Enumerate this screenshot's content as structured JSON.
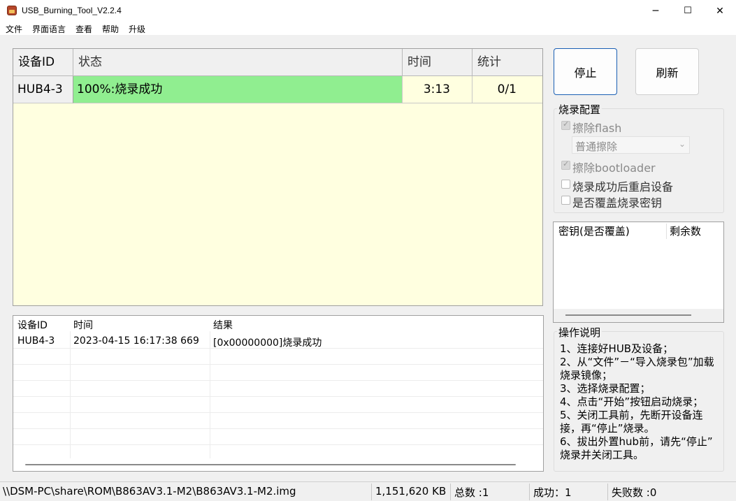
{
  "window": {
    "title": "USB_Burning_Tool_V2.2.4",
    "minimize": "─",
    "maximize": "☐",
    "close": "✕"
  },
  "menu": [
    "文件",
    "界面语言",
    "查看",
    "帮助",
    "升级"
  ],
  "grid": {
    "headers": [
      "设备ID",
      "状态",
      "时间",
      "统计"
    ],
    "rows": [
      {
        "device_id": "HUB4-3",
        "status": "100%:烧录成功",
        "time": "3:13",
        "stats": "0/1"
      }
    ],
    "colors": {
      "success": "#90ee90",
      "background": "#ffffe0"
    }
  },
  "log": {
    "headers": [
      "设备ID",
      "时间",
      "结果"
    ],
    "rows": [
      {
        "device_id": "HUB4-3",
        "time": "2023-04-15 16:17:38 669",
        "result": "[0x00000000]烧录成功"
      }
    ]
  },
  "buttons": {
    "stop": "停止",
    "refresh": "刷新"
  },
  "burn_config": {
    "title": "烧录配置",
    "erase_flash": {
      "label": "擦除flash",
      "checked": true
    },
    "erase_mode": "普通擦除",
    "erase_bootloader": {
      "label": "擦除bootloader",
      "checked": true
    },
    "reboot_after": {
      "label": "烧录成功后重启设备",
      "checked": false
    },
    "overwrite_key": {
      "label": "是否覆盖烧录密钥",
      "checked": false
    }
  },
  "key_list": {
    "headers": [
      "密钥(是否覆盖)",
      "剩余数"
    ]
  },
  "instructions": {
    "title": "操作说明",
    "lines": [
      "1、连接好HUB及设备；",
      "2、从“文件”－“导入烧录包”加载",
      "烧录镜像；",
      "3、选择烧录配置；",
      "4、点击“开始”按钮启动烧录；",
      "5、关闭工具前，先断开设备连",
      "接，再“停止”烧录。",
      "6、拔出外置hub前，请先“停止”",
      "烧录并关闭工具。"
    ]
  },
  "status_bar": {
    "path": "\\\\DSM-PC\\share\\ROM\\B863AV3.1-M2\\B863AV3.1-M2.img",
    "size": "1,151,620 KB",
    "total": "总数 :1",
    "success": "成功：1",
    "failed": "失败数 :0"
  }
}
